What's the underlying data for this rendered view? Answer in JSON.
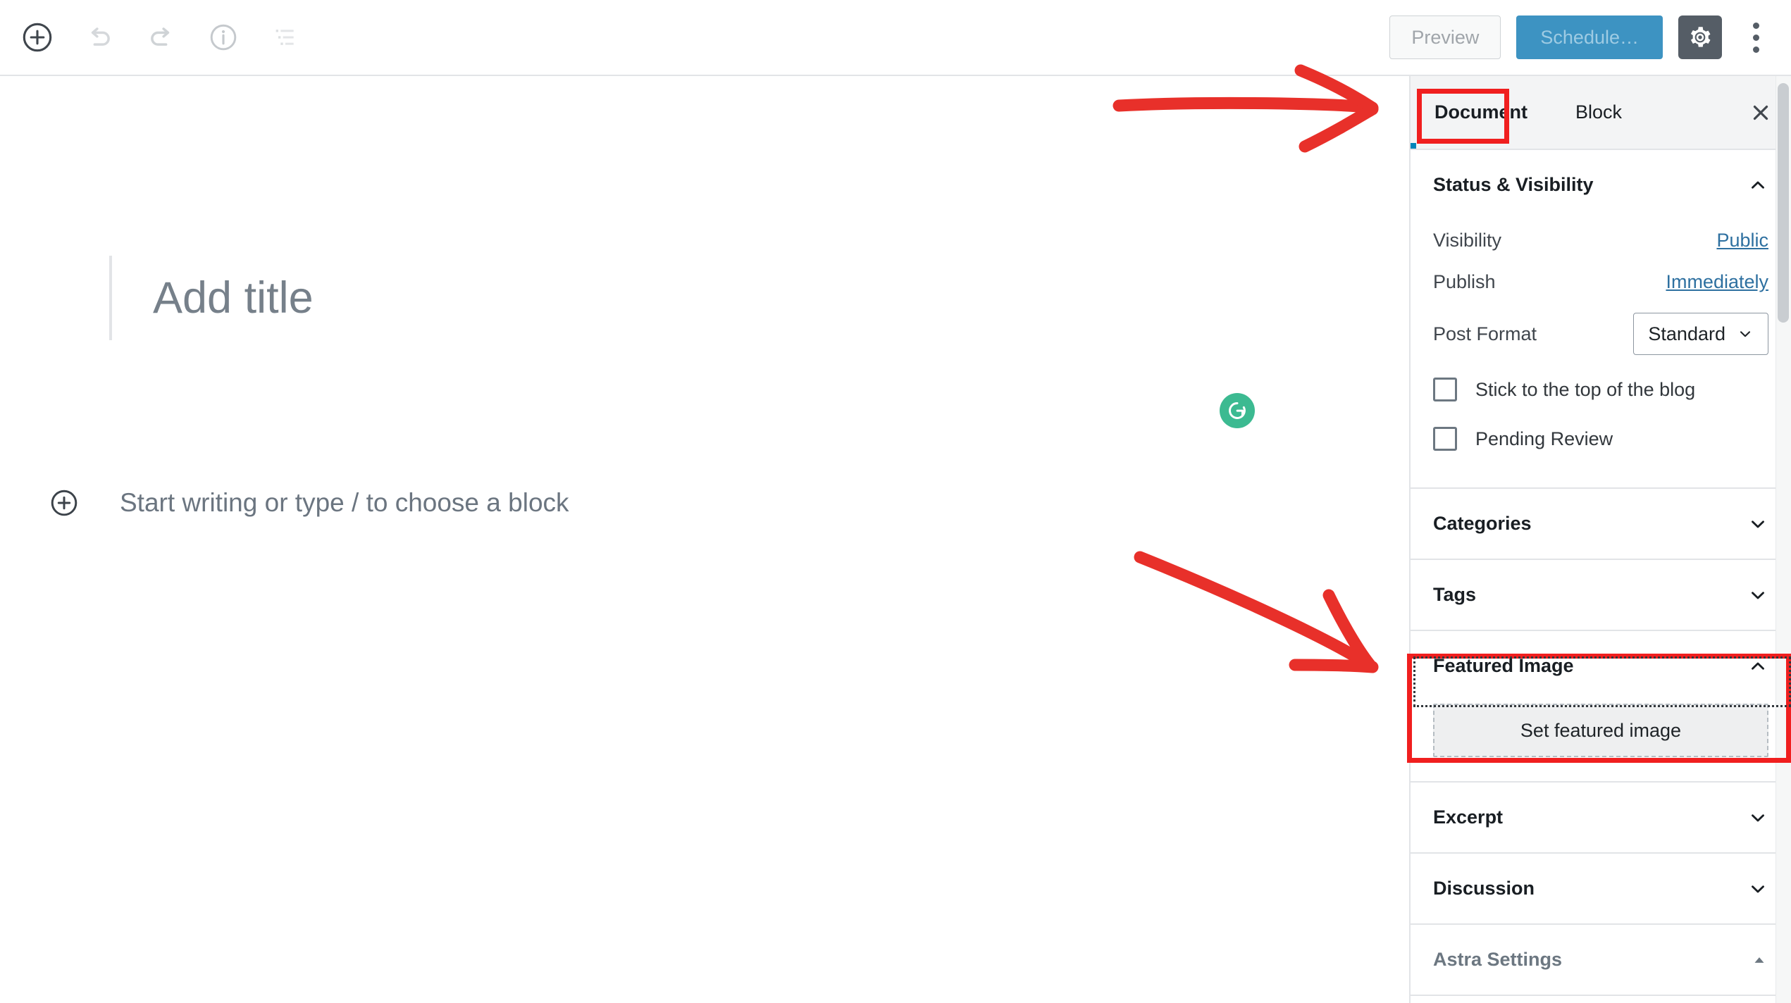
{
  "toolbar": {
    "add_block_label": "Add block",
    "undo_label": "Undo",
    "redo_label": "Redo",
    "info_label": "Content structure",
    "list_view_label": "Block navigation",
    "preview_label": "Preview",
    "schedule_label": "Schedule…",
    "settings_label": "Settings",
    "more_label": "More tools & options"
  },
  "editor": {
    "title_placeholder": "Add title",
    "paragraph_placeholder": "Start writing or type / to choose a block",
    "grammarly_label": "Grammarly",
    "inserter_label": "Add block"
  },
  "sidebar": {
    "tabs": [
      {
        "label": "Document",
        "active": true
      },
      {
        "label": "Block",
        "active": false
      }
    ],
    "close_label": "Close settings",
    "panels": [
      {
        "title": "Status & Visibility",
        "expanded": true,
        "rows": [
          {
            "label": "Visibility",
            "value": "Public"
          },
          {
            "label": "Publish",
            "value": "Immediately"
          }
        ],
        "post_format": {
          "label": "Post Format",
          "value": "Standard"
        },
        "checkboxes": [
          {
            "label": "Stick to the top of the blog",
            "checked": false
          },
          {
            "label": "Pending Review",
            "checked": false
          }
        ]
      },
      {
        "title": "Categories",
        "expanded": false
      },
      {
        "title": "Tags",
        "expanded": false
      },
      {
        "title": "Featured Image",
        "expanded": true,
        "button_label": "Set featured image",
        "highlighted": true
      },
      {
        "title": "Excerpt",
        "expanded": false
      },
      {
        "title": "Discussion",
        "expanded": false
      },
      {
        "title": "Astra Settings",
        "expanded": true,
        "muted": true
      }
    ]
  },
  "annotations": {
    "arrow_color": "#e8302a",
    "box_color": "#f01f1f",
    "arrows": [
      {
        "name": "arrow-to-document-tab"
      },
      {
        "name": "arrow-to-featured-image"
      }
    ],
    "boxes": [
      {
        "name": "highlight-document-tab"
      },
      {
        "name": "highlight-featured-image"
      }
    ]
  },
  "colors": {
    "accent_blue": "#0085ba",
    "link_blue": "#2e70a0",
    "schedule_bg": "#3d93c2",
    "gear_bg": "#555d66",
    "grammarly_green": "#3cba91",
    "border": "#e2e4e7"
  }
}
